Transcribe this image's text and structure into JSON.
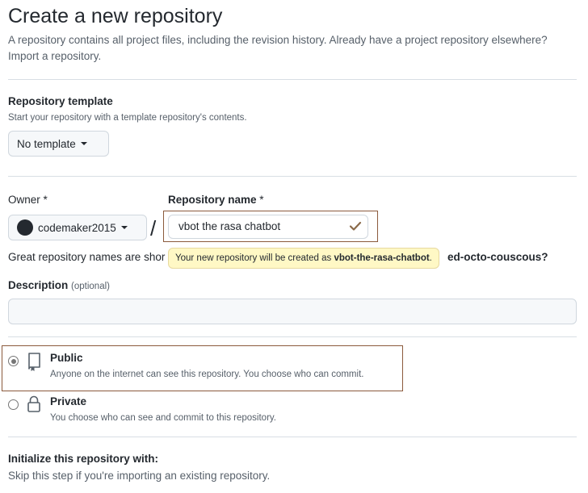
{
  "page": {
    "title": "Create a new repository",
    "subtitle": "A repository contains all project files, including the revision history. Already have a project repository elsewhere?",
    "import_link": "Import a repository."
  },
  "template": {
    "label": "Repository template",
    "help": "Start your repository with a template repository's contents.",
    "button_label": "No template"
  },
  "owner": {
    "label": "Owner",
    "required_mark": "*",
    "value": "codemaker2015"
  },
  "separator": "/",
  "repo_name": {
    "label": "Repository name",
    "required_mark": "*",
    "value": "vbot the rasa chatbot"
  },
  "tooltip": {
    "prefix": "Your new repository will be created as ",
    "slug": "vbot-the-rasa-chatbot",
    "suffix": "."
  },
  "suggestion": {
    "prefix": "Great repository names are shor",
    "suffix": "ed-octo-couscous?"
  },
  "description": {
    "label": "Description",
    "optional": "(optional)",
    "value": ""
  },
  "visibility": {
    "public": {
      "label": "Public",
      "help": "Anyone on the internet can see this repository. You choose who can commit.",
      "selected": true
    },
    "private": {
      "label": "Private",
      "help": "You choose who can see and commit to this repository.",
      "selected": false
    }
  },
  "initialize": {
    "label": "Initialize this repository with:",
    "help": "Skip this step if you're importing an existing repository."
  },
  "colors": {
    "highlight_border": "#8b5a3c",
    "tooltip_bg": "#fff8c5",
    "check": "#8a6a4a"
  }
}
